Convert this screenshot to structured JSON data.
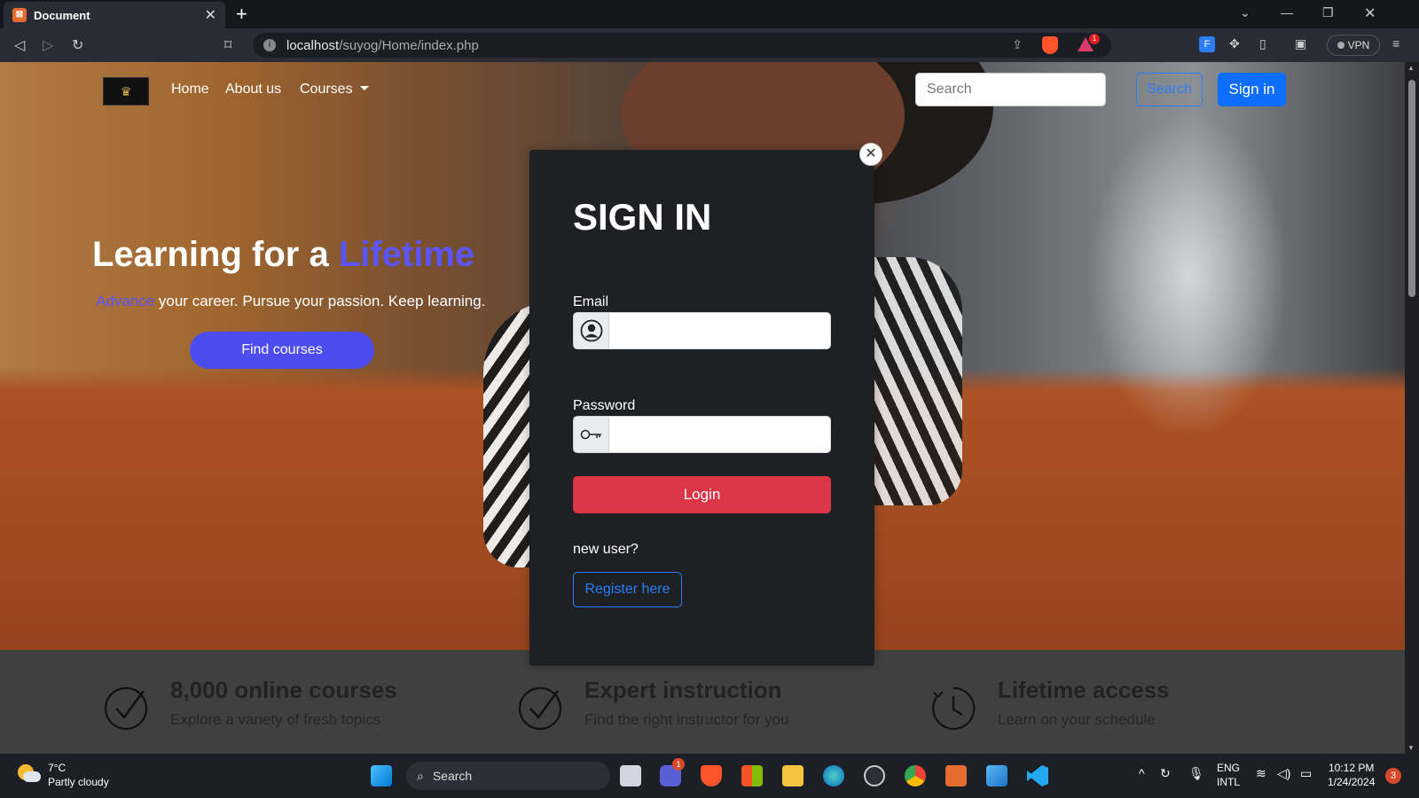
{
  "browser": {
    "tab_title": "Document",
    "tab_favicon": "xampp-icon",
    "url_host": "localhost",
    "url_path": "/suyog/Home/index.php",
    "vpn_label": "VPN",
    "rewards_badge": "1"
  },
  "nav": {
    "links": [
      "Home",
      "About us",
      "Courses"
    ],
    "search_placeholder": "Search",
    "search_button": "Search",
    "signin_button": "Sign in"
  },
  "hero": {
    "title_main": "Learning for a ",
    "title_accent": "Lifetime",
    "subtitle_accent": "Advance",
    "subtitle_rest": " your career. Pursue your passion. Keep learning.",
    "cta": "Find courses"
  },
  "features": [
    {
      "title": "8,000 online courses",
      "text": "Explore a variety of fresh topics",
      "icon": "checkmark-circle-icon"
    },
    {
      "title": "Expert instruction",
      "text": "Find the right instructor for you",
      "icon": "checkmark-circle-icon"
    },
    {
      "title": "Lifetime access",
      "text": "Learn on your schedule",
      "icon": "clock-history-icon"
    }
  ],
  "modal": {
    "title": "SIGN IN",
    "email_label": "Email",
    "email_value": "",
    "password_label": "Password",
    "password_value": "",
    "login_button": "Login",
    "new_user_text": "new user?",
    "register_button": "Register here"
  },
  "taskbar": {
    "weather_temp": "7°C",
    "weather_desc": "Partly cloudy",
    "search_label": "Search",
    "lang_top": "ENG",
    "lang_bottom": "INTL",
    "time": "10:12 PM",
    "date": "1/24/2024",
    "notification_count": "3",
    "teams_badge": "1"
  },
  "colors": {
    "accent": "#5b55f5",
    "primary": "#0d6efd",
    "danger": "#dc3545",
    "modal_bg": "#1e2024"
  }
}
